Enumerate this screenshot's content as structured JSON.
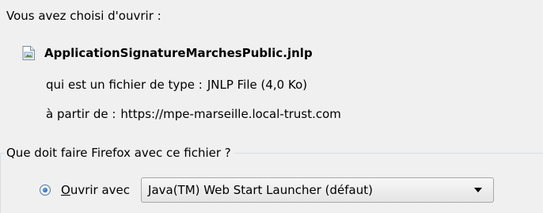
{
  "dialog": {
    "intro_text": "Vous avez choisi d'ouvrir :",
    "file": {
      "icon": "jnlp-file-icon",
      "name": "ApplicationSignatureMarchesPublic.jnlp"
    },
    "type_label": "qui est un fichier de type :",
    "type_value": "JNLP File (4,0 Ko)",
    "from_label": "à partir de :",
    "from_value": "https://mpe-marseille.local-trust.com"
  },
  "action_group": {
    "legend": "Que doit faire Firefox avec ce fichier ?",
    "open_with": {
      "selected": true,
      "label_accel": "O",
      "label_rest": "uvrir avec",
      "app_selected": "Java(TM) Web Start Launcher (défaut)"
    }
  },
  "colors": {
    "background": "#f0f0f0",
    "groupbox_line": "#d5dfe5",
    "radio_dot": "#1f5fb0"
  }
}
